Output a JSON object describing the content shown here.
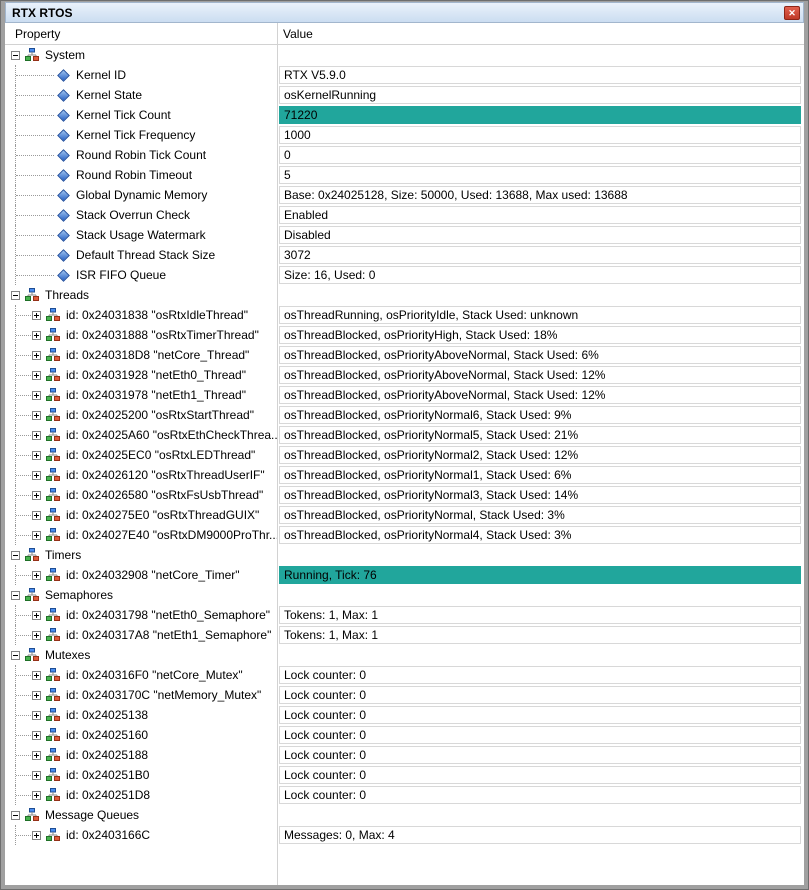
{
  "window": {
    "title": "RTX RTOS",
    "close_icon": "✕"
  },
  "header": {
    "property": "Property",
    "value": "Value"
  },
  "colors": {
    "highlight": "#21A69C",
    "cell_border": "#d8d8d8",
    "titlebar": "#cbddf1",
    "close_red": "#bf3a28"
  },
  "rows": [
    {
      "kind": "group",
      "expander": "minus",
      "icon": "module",
      "label": "System",
      "value": null
    },
    {
      "kind": "leaf",
      "icon": "diamond",
      "label": "Kernel ID",
      "value": "RTX V5.9.0"
    },
    {
      "kind": "leaf",
      "icon": "diamond",
      "label": "Kernel State",
      "value": "osKernelRunning"
    },
    {
      "kind": "leaf",
      "icon": "diamond",
      "label": "Kernel Tick Count",
      "value": "71220",
      "highlight": true
    },
    {
      "kind": "leaf",
      "icon": "diamond",
      "label": "Kernel Tick Frequency",
      "value": "1000"
    },
    {
      "kind": "leaf",
      "icon": "diamond",
      "label": "Round Robin Tick Count",
      "value": "0"
    },
    {
      "kind": "leaf",
      "icon": "diamond",
      "label": "Round Robin Timeout",
      "value": "5"
    },
    {
      "kind": "leaf",
      "icon": "diamond",
      "label": "Global Dynamic Memory",
      "value": "Base: 0x24025128, Size: 50000, Used: 13688, Max used: 13688"
    },
    {
      "kind": "leaf",
      "icon": "diamond",
      "label": "Stack Overrun Check",
      "value": "Enabled"
    },
    {
      "kind": "leaf",
      "icon": "diamond",
      "label": "Stack Usage Watermark",
      "value": "Disabled"
    },
    {
      "kind": "leaf",
      "icon": "diamond",
      "label": "Default Thread Stack Size",
      "value": "3072"
    },
    {
      "kind": "leaf",
      "icon": "diamond",
      "label": "ISR FIFO Queue",
      "value": "Size: 16, Used: 0"
    },
    {
      "kind": "group",
      "expander": "minus",
      "icon": "module",
      "label": "Threads",
      "value": null
    },
    {
      "kind": "item",
      "expander": "plus",
      "icon": "module",
      "label": "id: 0x24031838 \"osRtxIdleThread\"",
      "value": "osThreadRunning, osPriorityIdle, Stack Used: unknown"
    },
    {
      "kind": "item",
      "expander": "plus",
      "icon": "module",
      "label": "id: 0x24031888 \"osRtxTimerThread\"",
      "value": "osThreadBlocked, osPriorityHigh, Stack Used: 18%"
    },
    {
      "kind": "item",
      "expander": "plus",
      "icon": "module",
      "label": "id: 0x240318D8 \"netCore_Thread\"",
      "value": "osThreadBlocked, osPriorityAboveNormal, Stack Used: 6%"
    },
    {
      "kind": "item",
      "expander": "plus",
      "icon": "module",
      "label": "id: 0x24031928 \"netEth0_Thread\"",
      "value": "osThreadBlocked, osPriorityAboveNormal, Stack Used: 12%"
    },
    {
      "kind": "item",
      "expander": "plus",
      "icon": "module",
      "label": "id: 0x24031978 \"netEth1_Thread\"",
      "value": "osThreadBlocked, osPriorityAboveNormal, Stack Used: 12%"
    },
    {
      "kind": "item",
      "expander": "plus",
      "icon": "module",
      "label": "id: 0x24025200 \"osRtxStartThread\"",
      "value": "osThreadBlocked, osPriorityNormal6, Stack Used: 9%"
    },
    {
      "kind": "item",
      "expander": "plus",
      "icon": "module",
      "label": "id: 0x24025A60 \"osRtxEthCheckThrea...\"",
      "value": "osThreadBlocked, osPriorityNormal5, Stack Used: 21%"
    },
    {
      "kind": "item",
      "expander": "plus",
      "icon": "module",
      "label": "id: 0x24025EC0 \"osRtxLEDThread\"",
      "value": "osThreadBlocked, osPriorityNormal2, Stack Used: 12%"
    },
    {
      "kind": "item",
      "expander": "plus",
      "icon": "module",
      "label": "id: 0x24026120 \"osRtxThreadUserIF\"",
      "value": "osThreadBlocked, osPriorityNormal1, Stack Used: 6%"
    },
    {
      "kind": "item",
      "expander": "plus",
      "icon": "module",
      "label": "id: 0x24026580 \"osRtxFsUsbThread\"",
      "value": "osThreadBlocked, osPriorityNormal3, Stack Used: 14%"
    },
    {
      "kind": "item",
      "expander": "plus",
      "icon": "module",
      "label": "id: 0x240275E0 \"osRtxThreadGUIX\"",
      "value": "osThreadBlocked, osPriorityNormal, Stack Used: 3%"
    },
    {
      "kind": "item",
      "expander": "plus",
      "icon": "module",
      "label": "id: 0x24027E40 \"osRtxDM9000ProThr...\"",
      "value": "osThreadBlocked, osPriorityNormal4, Stack Used: 3%"
    },
    {
      "kind": "group",
      "expander": "minus",
      "icon": "module",
      "label": "Timers",
      "value": null
    },
    {
      "kind": "item",
      "expander": "plus",
      "icon": "module",
      "label": "id: 0x24032908 \"netCore_Timer\"",
      "value": "Running, Tick: 76",
      "highlight": true
    },
    {
      "kind": "group",
      "expander": "minus",
      "icon": "module",
      "label": "Semaphores",
      "value": null
    },
    {
      "kind": "item",
      "expander": "plus",
      "icon": "module",
      "label": "id: 0x24031798 \"netEth0_Semaphore\"",
      "value": "Tokens: 1, Max: 1"
    },
    {
      "kind": "item",
      "expander": "plus",
      "icon": "module",
      "label": "id: 0x240317A8 \"netEth1_Semaphore\"",
      "value": "Tokens: 1, Max: 1"
    },
    {
      "kind": "group",
      "expander": "minus",
      "icon": "module",
      "label": "Mutexes",
      "value": null
    },
    {
      "kind": "item",
      "expander": "plus",
      "icon": "module",
      "label": "id: 0x240316F0 \"netCore_Mutex\"",
      "value": "Lock counter: 0"
    },
    {
      "kind": "item",
      "expander": "plus",
      "icon": "module",
      "label": "id: 0x2403170C \"netMemory_Mutex\"",
      "value": "Lock counter: 0"
    },
    {
      "kind": "item",
      "expander": "plus",
      "icon": "module",
      "label": "id: 0x24025138",
      "value": "Lock counter: 0"
    },
    {
      "kind": "item",
      "expander": "plus",
      "icon": "module",
      "label": "id: 0x24025160",
      "value": "Lock counter: 0"
    },
    {
      "kind": "item",
      "expander": "plus",
      "icon": "module",
      "label": "id: 0x24025188",
      "value": "Lock counter: 0"
    },
    {
      "kind": "item",
      "expander": "plus",
      "icon": "module",
      "label": "id: 0x240251B0",
      "value": "Lock counter: 0"
    },
    {
      "kind": "item",
      "expander": "plus",
      "icon": "module",
      "label": "id: 0x240251D8",
      "value": "Lock counter: 0"
    },
    {
      "kind": "group",
      "expander": "minus",
      "icon": "module",
      "label": "Message Queues",
      "value": null
    },
    {
      "kind": "item",
      "expander": "plus",
      "icon": "module",
      "label": "id: 0x2403166C",
      "value": "Messages: 0, Max: 4"
    }
  ]
}
